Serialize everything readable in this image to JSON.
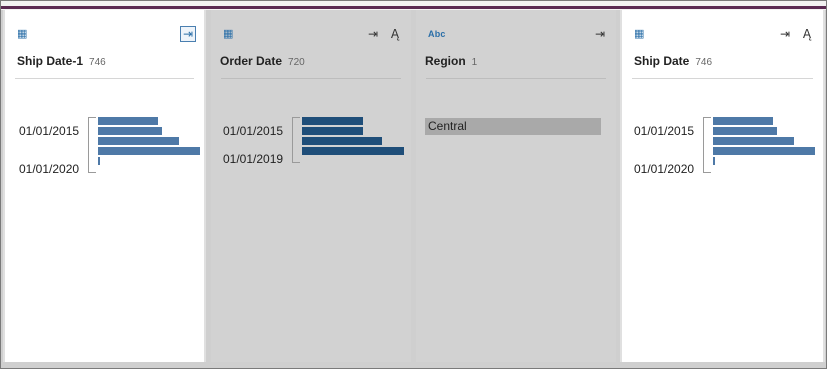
{
  "cards": [
    {
      "title": "Ship Date-1",
      "count": "746",
      "type_icon": "calendar-icon",
      "selected": true,
      "actions": [
        "field-export-icon"
      ],
      "axis_labels": [
        "01/01/2015",
        "01/01/2020"
      ],
      "bars": [
        0.59,
        0.63,
        0.79,
        1.0,
        0.02
      ]
    },
    {
      "title": "Order Date",
      "count": "720",
      "type_icon": "calendar-icon",
      "selected": false,
      "actions": [
        "field-export-icon",
        "clean-icon"
      ],
      "axis_labels": [
        "01/01/2015",
        "01/01/2019"
      ],
      "bars": [
        0.6,
        0.6,
        0.78,
        1.0
      ]
    },
    {
      "title": "Region",
      "count": "1",
      "type_icon": "abc-icon",
      "type_label": "Abc",
      "selected": false,
      "actions": [
        "field-export-icon"
      ],
      "categories": [
        "Central"
      ]
    },
    {
      "title": "Ship Date",
      "count": "746",
      "type_icon": "calendar-icon",
      "selected": true,
      "actions": [
        "field-export-icon",
        "clean-icon"
      ],
      "axis_labels": [
        "01/01/2015",
        "01/01/2020"
      ],
      "bars": [
        0.59,
        0.63,
        0.79,
        1.0,
        0.02
      ]
    }
  ],
  "icons": {
    "calendar": "▦",
    "export": "⇥",
    "clean": "Ą"
  }
}
